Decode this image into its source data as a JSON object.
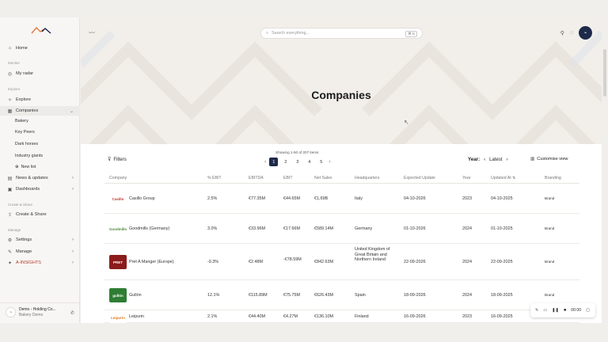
{
  "sidebar": {
    "home": "Home",
    "section_monitor": "Monitor",
    "my_radar": "My radar",
    "section_explore": "Explore",
    "explore": "Explore",
    "companies": "Companies",
    "sub": [
      "Bakery",
      "Key Peers",
      "Dark horses",
      "Industry giants",
      "New list"
    ],
    "news": "News & updates",
    "dashboards": "Dashboards",
    "section_create": "Create & Share",
    "create_share": "Create & Share",
    "section_manage": "Manage",
    "settings": "Settings",
    "manage": "Manage",
    "insights": "A-INSIGHTS",
    "account_name": "Demo - Holding Co...",
    "account_sub": "Bakery Demo"
  },
  "header": {
    "search_placeholder": "Search everything...",
    "search_kbd": "⌘ K",
    "page_title": "Companies"
  },
  "controls": {
    "filters": "Filters",
    "showing": "Showing 1-50 of 207 items",
    "pages": [
      "1",
      "2",
      "3",
      "4",
      "5"
    ],
    "year_label": "Year:",
    "year_value": "Latest",
    "customise": "Customise view"
  },
  "table": {
    "headers": [
      "Company",
      "% EBIT",
      "EBITDA",
      "EBIT",
      "Net Sales",
      "Headquarters",
      "Expected Update",
      "Year",
      "Updated At",
      "Branding"
    ],
    "rows": [
      {
        "logo": "Casillo",
        "logo_bg": "#ffffff",
        "logo_color": "#c0392b",
        "company": "Casillo Group",
        "pct_ebit": "2.5%",
        "ebitda": "€77.35M",
        "ebit": "€44.65M",
        "net_sales": "€1,69B",
        "hq": "Italy",
        "expected": "04-10-2026",
        "year": "2023",
        "updated": "04-10-2025",
        "branding": "Brand"
      },
      {
        "logo": "Goodmills",
        "logo_bg": "#ffffff",
        "logo_color": "#4a8a3a",
        "company": "Goodmills (Germany)",
        "pct_ebit": "3.0%",
        "ebitda": "€33.96M",
        "ebit": "€17.66M",
        "net_sales": "€589.14M",
        "hq": "Germany",
        "expected": "01-10-2026",
        "year": "2024",
        "updated": "01-10-2025",
        "branding": "Brand"
      },
      {
        "logo": "PRET",
        "logo_bg": "#8c1b1b",
        "logo_color": "#ffffff",
        "company": "Pret A Manger (Europe)",
        "pct_ebit": "-9.3%",
        "ebitda": "€2.48M",
        "ebit": "-€78.59M",
        "net_sales": "€842.63M",
        "hq": "United Kingdom of Great Britain and Northern Ireland",
        "expected": "22-09-2026",
        "year": "2024",
        "updated": "22-09-2025",
        "branding": "Brand"
      },
      {
        "logo": "gullón",
        "logo_bg": "#2e7d32",
        "logo_color": "#ffffff",
        "company": "Gullón",
        "pct_ebit": "12.1%",
        "ebitda": "€115.89M",
        "ebit": "€75.75M",
        "net_sales": "€626.43M",
        "hq": "Spain",
        "expected": "18-09-2026",
        "year": "2024",
        "updated": "18-09-2025",
        "branding": "Brand"
      },
      {
        "logo": "Leipurin",
        "logo_bg": "#ffffff",
        "logo_color": "#d97a1e",
        "company": "Leipurin",
        "pct_ebit": "2.1%",
        "ebitda": "€44.40M",
        "ebit": "€4.27M",
        "net_sales": "€136.10M",
        "hq": "Finland",
        "expected": "16-09-2026",
        "year": "2023",
        "updated": "16-09-2025",
        "branding": "Private La..."
      }
    ]
  },
  "recorder": {
    "time": "00:00"
  },
  "colors": {
    "accent": "#1d2a4a",
    "insight_red": "#b0392b"
  }
}
